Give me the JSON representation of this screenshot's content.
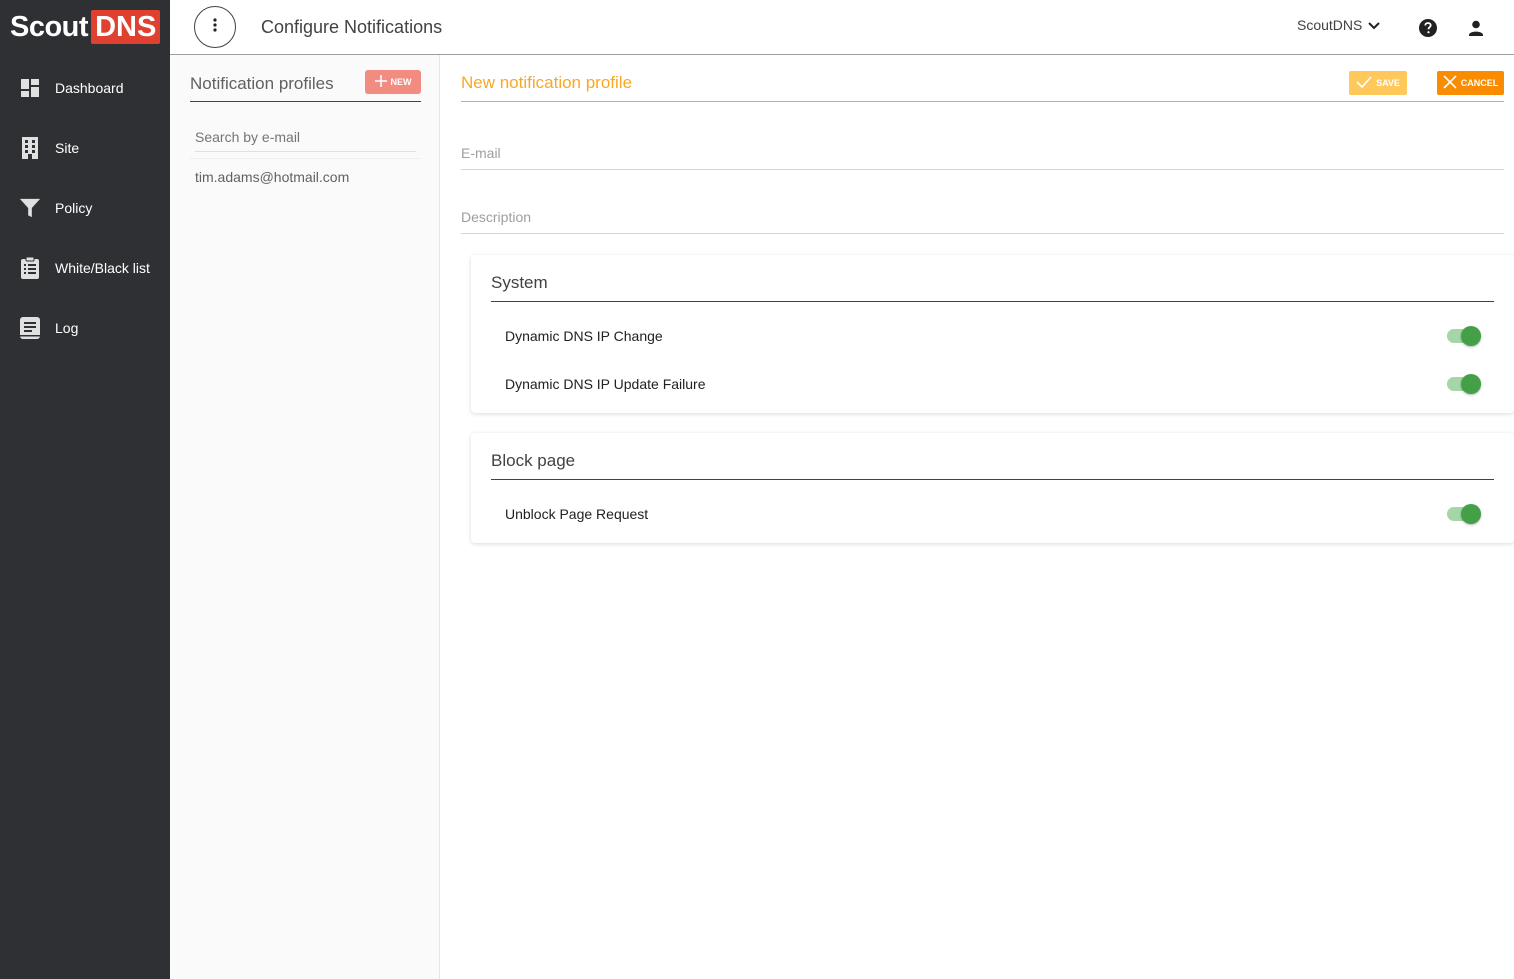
{
  "brand": {
    "scout": "Scout",
    "dns": "DNS",
    "accent": "#e0402f"
  },
  "sidebar": {
    "items": [
      {
        "label": "Dashboard",
        "icon": "dashboard-icon"
      },
      {
        "label": "Site",
        "icon": "building-icon"
      },
      {
        "label": "Policy",
        "icon": "filter-icon"
      },
      {
        "label": "White/Black list",
        "icon": "clipboard-list-icon"
      },
      {
        "label": "Log",
        "icon": "book-icon"
      }
    ]
  },
  "header": {
    "title": "Configure Notifications",
    "account": "ScoutDNS",
    "menu_icon": "more-vert-icon",
    "help_icon": "help-icon",
    "user_icon": "person-icon"
  },
  "profiles": {
    "title": "Notification profiles",
    "new_label": "NEW",
    "search_placeholder": "Search by e-mail",
    "items": [
      {
        "email": "tim.adams@hotmail.com"
      }
    ]
  },
  "form": {
    "title": "New notification profile",
    "save_label": "SAVE",
    "cancel_label": "CANCEL",
    "email_placeholder": "E-mail",
    "description_placeholder": "Description",
    "sections": [
      {
        "title": "System",
        "toggles": [
          {
            "label": "Dynamic DNS IP Change",
            "on": true
          },
          {
            "label": "Dynamic DNS IP Update Failure",
            "on": true
          }
        ]
      },
      {
        "title": "Block page",
        "toggles": [
          {
            "label": "Unblock Page Request",
            "on": true
          }
        ]
      }
    ]
  },
  "colors": {
    "sidebar_bg": "#2f3033",
    "primary_orange": "#f98c00",
    "save_yellow": "#ffc85a",
    "title_amber": "#f9a825",
    "new_salmon": "#f28b80",
    "toggle_green": "#43a047"
  }
}
